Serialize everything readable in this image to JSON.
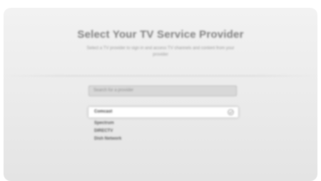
{
  "screen": {
    "title": "Select Your TV Service Provider",
    "subtitle": "Select a TV provider to sign in and access TV channels and content from your provider"
  },
  "search": {
    "placeholder": "Search for a provider"
  },
  "providers": {
    "selected_icon": "check-circle-icon",
    "items": [
      {
        "label": "Comcast",
        "selected": true
      },
      {
        "label": "Spectrum",
        "selected": false
      },
      {
        "label": "DIRECTV",
        "selected": false
      },
      {
        "label": "Dish Network",
        "selected": false
      }
    ]
  }
}
